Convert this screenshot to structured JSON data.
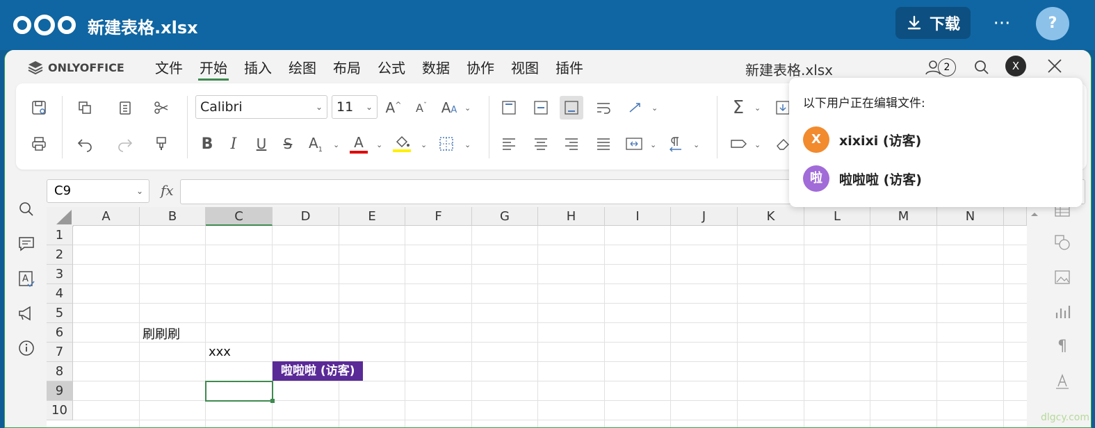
{
  "topbar": {
    "title": "新建表格.xlsx",
    "download_label": "下载",
    "more": "···",
    "help": "?"
  },
  "editor": {
    "brand": "ONLYOFFICE",
    "menu": [
      "文件",
      "开始",
      "插入",
      "绘图",
      "布局",
      "公式",
      "数据",
      "协作",
      "视图",
      "插件"
    ],
    "active_menu": "开始",
    "doc_name": "新建表格.xlsx",
    "users_count": "2",
    "avatar_initial": "X"
  },
  "ribbon": {
    "font": "Calibri",
    "size": "11",
    "colors": {
      "font_color": "#e10000",
      "fill_color": "#fff000"
    }
  },
  "formula": {
    "cell_ref": "C9",
    "fx": "fx",
    "value": ""
  },
  "sheet": {
    "columns": [
      "A",
      "B",
      "C",
      "D",
      "E",
      "F",
      "G",
      "H",
      "I",
      "J",
      "K",
      "L",
      "M",
      "N"
    ],
    "rows": [
      "1",
      "2",
      "3",
      "4",
      "5",
      "6",
      "7",
      "8",
      "9",
      "10"
    ],
    "selected_column": "C",
    "selected_row": "9",
    "cells": {
      "B6": "刷刷刷",
      "C7": "xxx"
    },
    "collab_flag": "啦啦啦 (访客)",
    "collab_color": "#5a2a97"
  },
  "popup": {
    "title": "以下用户正在编辑文件:",
    "users": [
      {
        "initial": "X",
        "name": "xixixi (访客)",
        "color": "#f28a2e"
      },
      {
        "initial": "啦",
        "name": "啦啦啦 (访客)",
        "color": "#a16bd8"
      }
    ]
  },
  "watermark": "dlgcy.com"
}
